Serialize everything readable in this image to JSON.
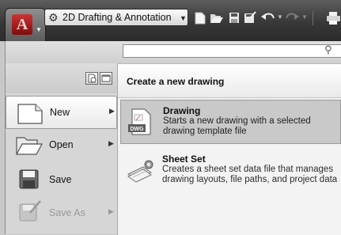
{
  "quick_access": {
    "app_logo": "A",
    "workspace": {
      "label": "2D Drafting & Annotation"
    },
    "icons": [
      "qnew-icon",
      "qopen-icon",
      "qsave-icon",
      "qsaveas-icon",
      "undo-icon",
      "redo-icon",
      "plot-icon"
    ]
  },
  "app_menu": {
    "search": {
      "value": "",
      "placeholder": ""
    },
    "commands": [
      {
        "label": "New",
        "enabled": true,
        "selected": true,
        "has_submenu": true
      },
      {
        "label": "Open",
        "enabled": true,
        "selected": false,
        "has_submenu": true
      },
      {
        "label": "Save",
        "enabled": true,
        "selected": false,
        "has_submenu": false
      },
      {
        "label": "Save As",
        "enabled": false,
        "selected": false,
        "has_submenu": true
      }
    ]
  },
  "new_panel": {
    "title": "Create a new drawing",
    "entries": [
      {
        "title": "Drawing",
        "description": "Starts a new drawing with a selected drawing template file",
        "icon_text": "DWG",
        "highlighted": true
      },
      {
        "title": "Sheet Set",
        "description": "Creates a sheet set data file that manages drawing layouts, file paths, and project data",
        "highlighted": false
      }
    ]
  },
  "colors": {
    "title_bar": "#383838",
    "menu_background": "#d6d6d6",
    "panel_background": "#f3f3f3",
    "highlight": "#c9c9c9",
    "logo_red": "#b52020"
  }
}
